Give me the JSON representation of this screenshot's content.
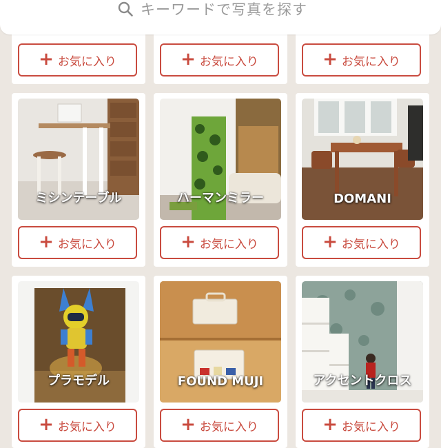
{
  "search": {
    "placeholder": "キーワードで写真を探す",
    "icon": "search-icon"
  },
  "favorite_label": "お気に入り",
  "favorite_icon": "plus-icon",
  "accent_color": "#c94b3f",
  "rows": [
    {
      "items": [
        {
          "title": ""
        },
        {
          "title": ""
        },
        {
          "title": ""
        }
      ]
    },
    {
      "items": [
        {
          "title": "ミシンテーブル"
        },
        {
          "title": "ハーマンミラー"
        },
        {
          "title": "DOMANI"
        }
      ]
    },
    {
      "items": [
        {
          "title": "プラモデル"
        },
        {
          "title": "FOUND MUJI"
        },
        {
          "title": "アクセントクロス"
        }
      ]
    }
  ]
}
